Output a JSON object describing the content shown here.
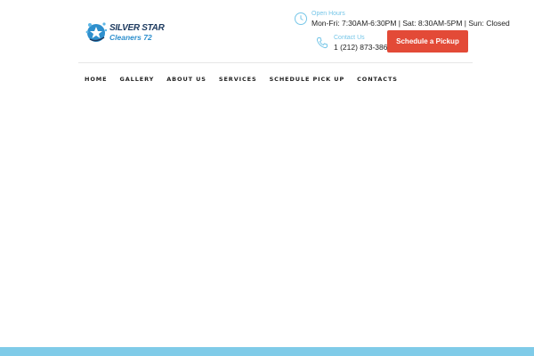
{
  "logo": {
    "line1": "SILVER STAR",
    "line2": "Cleaners 72",
    "icon": "star-drop-logo-icon"
  },
  "hours": {
    "label": "Open Hours",
    "value": "Mon-Fri: 7:30AM-6:30PM | Sat: 8:30AM-5PM | Sun: Closed",
    "icon": "clock-icon"
  },
  "contact": {
    "label": "Contact Us",
    "value": "1 (212) 873-3864",
    "icon": "phone-icon"
  },
  "cta": {
    "label": "Schedule a Pickup"
  },
  "nav": {
    "items": [
      {
        "label": "HOME"
      },
      {
        "label": "GALLERY"
      },
      {
        "label": "ABOUT US"
      },
      {
        "label": "SERVICES"
      },
      {
        "label": "SCHEDULE PICK UP"
      },
      {
        "label": "CONTACTS"
      }
    ]
  },
  "colors": {
    "accent": "#e34a37",
    "light_blue": "#76c6e8",
    "brand_blue": "#2e8fcd",
    "brand_dark": "#1d3a5f",
    "footer_band": "#7fcbe8"
  }
}
